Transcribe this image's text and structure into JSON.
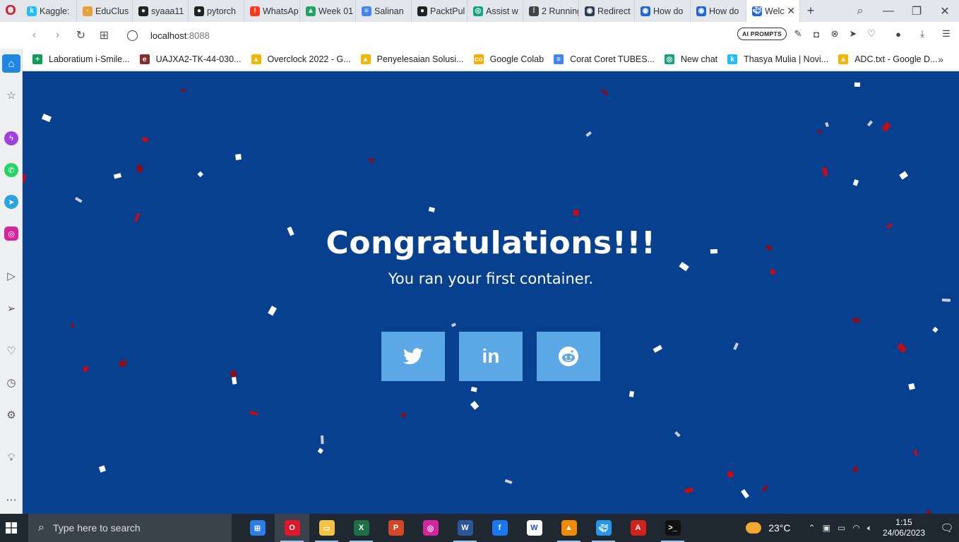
{
  "tabs": [
    {
      "title": "Kaggle:",
      "color": "#20beff",
      "glyph": "k"
    },
    {
      "title": "EduClus",
      "color": "#e8a23b",
      "glyph": "·"
    },
    {
      "title": "syaaa11",
      "color": "#222222",
      "glyph": "●"
    },
    {
      "title": "pytorch",
      "color": "#222222",
      "glyph": "●"
    },
    {
      "title": "WhatsAp",
      "color": "#ff3b1f",
      "glyph": "!"
    },
    {
      "title": "Week 01",
      "color": "#1fa463",
      "glyph": "▲"
    },
    {
      "title": "Salinan",
      "color": "#4285f4",
      "glyph": "≡"
    },
    {
      "title": "PacktPul",
      "color": "#222222",
      "glyph": "●"
    },
    {
      "title": "Assist w",
      "color": "#10a37f",
      "glyph": "◎"
    },
    {
      "title": "2 Running",
      "color": "#444444",
      "glyph": "⁞"
    },
    {
      "title": "Redirect",
      "color": "#2b3a55",
      "glyph": "◉"
    },
    {
      "title": "How do",
      "color": "#1d63ed",
      "glyph": "◉"
    },
    {
      "title": "How do",
      "color": "#1d63ed",
      "glyph": "◉"
    }
  ],
  "active_tab": {
    "title": "Welc",
    "color": "#1d63ed"
  },
  "address": {
    "host": "localhost",
    "port": ":8088"
  },
  "ai_prompts_label": "AI PROMPTS",
  "bookmarks": [
    {
      "label": "Laboratium i-Smile...",
      "color": "#0f9d58",
      "glyph": "+"
    },
    {
      "label": "UAJXA2-TK-44-030...",
      "color": "#8a2d2d",
      "glyph": "e"
    },
    {
      "label": "Overclock 2022 - G...",
      "color": "#f4b400",
      "glyph": "▲"
    },
    {
      "label": "Penyelesaian Solusi...",
      "color": "#f4b400",
      "glyph": "▲"
    },
    {
      "label": "Google Colab",
      "color": "#f9ab00",
      "glyph": "co"
    },
    {
      "label": "Corat Coret TUBES...",
      "color": "#4285f4",
      "glyph": "≡"
    },
    {
      "label": "New chat",
      "color": "#10a37f",
      "glyph": "◎"
    },
    {
      "label": "Thasya Mulia | Novi...",
      "color": "#20beff",
      "glyph": "k"
    },
    {
      "label": "ADC.txt - Google D...",
      "color": "#f4b400",
      "glyph": "▲"
    }
  ],
  "page": {
    "headline": "Congratulations!!!",
    "subline": "You ran your first container."
  },
  "social": [
    {
      "name": "twitter",
      "glyph": "🐦︎"
    },
    {
      "name": "linkedin",
      "glyph": "in"
    },
    {
      "name": "reddit",
      "glyph": "◕"
    }
  ],
  "taskbar": {
    "search_placeholder": "Type here to search",
    "weather": "23°C",
    "time": "1:15",
    "date": "24/06/2023"
  },
  "taskbar_apps": [
    {
      "name": "microsoft-store",
      "color": "#2b7de9",
      "glyph": "⊞"
    },
    {
      "name": "opera",
      "color": "#e0162b",
      "glyph": "O"
    },
    {
      "name": "file-explorer",
      "color": "#f5c242",
      "glyph": "▭"
    },
    {
      "name": "excel",
      "color": "#1d7044",
      "glyph": "X"
    },
    {
      "name": "powerpoint",
      "color": "#d24726",
      "glyph": "P"
    },
    {
      "name": "instagram",
      "color": "#d6249f",
      "glyph": "◎"
    },
    {
      "name": "word",
      "color": "#2b579a",
      "glyph": "W"
    },
    {
      "name": "facebook",
      "color": "#1877f2",
      "glyph": "f"
    },
    {
      "name": "app-w",
      "color": "#ffffff",
      "glyph": "W"
    },
    {
      "name": "vlc",
      "color": "#f08a00",
      "glyph": "▲"
    },
    {
      "name": "docker",
      "color": "#2496ed",
      "glyph": "🐳︎"
    },
    {
      "name": "acrobat",
      "color": "#d4211b",
      "glyph": "A"
    },
    {
      "name": "terminal",
      "color": "#111111",
      "glyph": ">_"
    }
  ]
}
